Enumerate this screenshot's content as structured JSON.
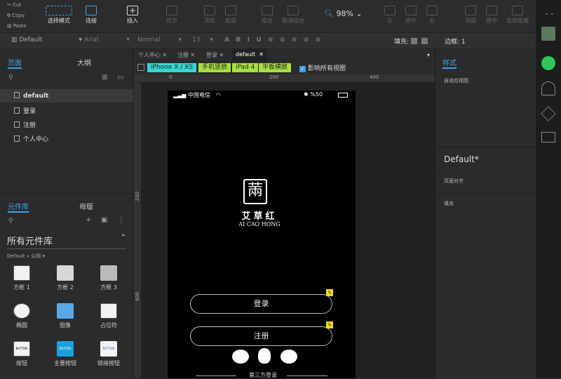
{
  "clipboard": {
    "cut": "Cut",
    "copy": "Copy",
    "paste": "Paste"
  },
  "toolbar": {
    "select_mode": "选择模式",
    "connect": "连接",
    "insert": "插入",
    "point": "控点",
    "top": "顶层",
    "bottom": "底层",
    "group": "组合",
    "ungroup": "取消组合",
    "zoom": "98%",
    "left": "左",
    "center": "居中",
    "right": "右",
    "top_align": "顶部",
    "middle": "居中",
    "bottom_distribute": "底部距离"
  },
  "format": {
    "style": "Default",
    "font": "Arial",
    "weight": "Normal",
    "size": "13",
    "fill_label": "填充:",
    "border_label": "边框:",
    "border_value": "1"
  },
  "left_panel": {
    "pages_tab": "页面",
    "outline_tab": "大纲",
    "pages": [
      "default",
      "登录",
      "注册",
      "个人中心"
    ],
    "library_tab": "元件库",
    "master_tab": "母版",
    "library_select": "所有元件库",
    "library_group": "Default » 公用 ▾",
    "widgets": [
      "方框 1",
      "方框 2",
      "方框 3",
      "椭圆",
      "图像",
      "占位符",
      "按钮",
      "主要按钮",
      "链接按钮"
    ],
    "button_caption": "BUTTON"
  },
  "doc_tabs": [
    "个人中心",
    "注册",
    "登录",
    "default"
  ],
  "views": [
    "iPhone X / XS",
    "手机竖放",
    "iPad 4",
    "平板横放"
  ],
  "affect_all": "影响所有视图",
  "ruler_marks": [
    "0",
    "200",
    "400"
  ],
  "vruler_marks": [
    "200",
    "400"
  ],
  "phone": {
    "carrier": "中国电信",
    "battery": "%50",
    "brand_cn": "艾草红",
    "brand_en": "AI CAO HONG",
    "login": "登录",
    "register": "注册",
    "third_party": "第三方登录"
  },
  "right_panel": {
    "tab": "样式",
    "adaptive": "自适应视图",
    "style_name": "Default*",
    "page_align": "页面对齐",
    "fill": "填充"
  },
  "colors": {
    "accent": "#3aa3e8",
    "view_cyan": "#36d6d6",
    "view_green": "#a6e043",
    "bolt": "#f4d81e"
  }
}
